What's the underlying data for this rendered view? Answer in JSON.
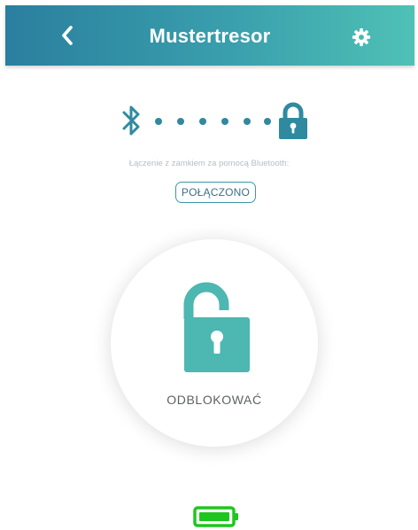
{
  "header": {
    "title": "Mustertresor",
    "back_icon": "chevron-left-icon",
    "settings_icon": "gear-icon"
  },
  "connection": {
    "bluetooth_icon": "bluetooth-icon",
    "lock_icon": "lock-closed-icon",
    "caption": "Łączenie z zamkiem za pomocą Bluetooth:",
    "status": "POŁĄCZONO"
  },
  "unlock": {
    "icon": "lock-open-icon",
    "label": "ODBLOKOWAĆ"
  },
  "battery": {
    "icon": "battery-full-icon",
    "level": 1.0
  },
  "colors": {
    "header_start": "#2a7f9e",
    "header_end": "#4fc1b6",
    "accent": "#2f8aa0",
    "lock_teal": "#4db7b1",
    "battery_green": "#1fc51f"
  }
}
